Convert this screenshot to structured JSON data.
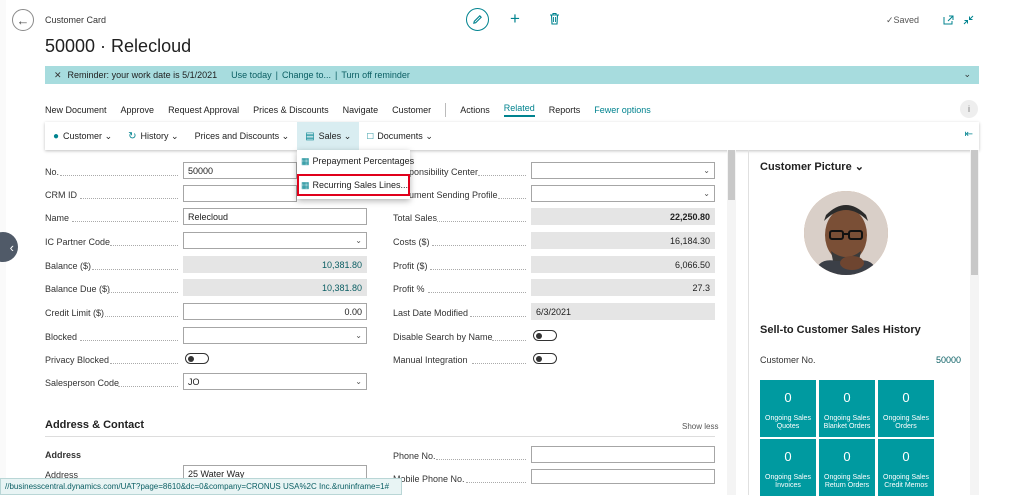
{
  "header": {
    "breadcrumb": "Customer Card",
    "title": "50000 · Relecloud",
    "saved_label": "Saved"
  },
  "reminder": {
    "text": "Reminder: your work date is 5/1/2021",
    "use_today": "Use today",
    "sep1": "|",
    "change_to": "Change to...",
    "sep2": "|",
    "turn_off": "Turn off reminder"
  },
  "action_tabs": [
    "New Document",
    "Approve",
    "Request Approval",
    "Prices & Discounts",
    "Navigate",
    "Customer",
    "Actions",
    "Related",
    "Reports",
    "Fewer options"
  ],
  "subbar": {
    "customer": "Customer",
    "history": "History",
    "prices": "Prices and Discounts",
    "sales": "Sales",
    "documents": "Documents"
  },
  "sales_menu": {
    "item1": "Prepayment Percentages",
    "item2": "Recurring Sales Lines..."
  },
  "general_left": {
    "no_label": "No.",
    "no_value": "50000",
    "crm_label": "CRM ID",
    "crm_value": "",
    "name_label": "Name",
    "name_value": "Relecloud",
    "ic_label": "IC Partner Code",
    "ic_value": "",
    "balance_label": "Balance ($)",
    "balance_value": "10,381.80",
    "baldue_label": "Balance Due ($)",
    "baldue_value": "10,381.80",
    "credit_label": "Credit Limit ($)",
    "credit_value": "0.00",
    "blocked_label": "Blocked",
    "blocked_value": "",
    "privacy_label": "Privacy Blocked",
    "sales_label": "Salesperson Code",
    "sales_value": "JO"
  },
  "general_right": {
    "resp_label": "Responsibility Center",
    "docsend_label": "Document Sending Profile",
    "total_label": "Total Sales",
    "total_value": "22,250.80",
    "costs_label": "Costs ($)",
    "costs_value": "16,184.30",
    "profit_label": "Profit ($)",
    "profit_value": "6,066.50",
    "profitpct_label": "Profit %",
    "profitpct_value": "27.3",
    "lastmod_label": "Last Date Modified",
    "lastmod_value": "6/3/2021",
    "disable_label": "Disable Search by Name",
    "manual_label": "Manual Integration"
  },
  "address": {
    "section_title": "Address & Contact",
    "show_less": "Show less",
    "sub_heading": "Address",
    "address_label": "Address",
    "address_value": "25 Water Way",
    "phone_label": "Phone No.",
    "mobile_label": "Mobile Phone No."
  },
  "factbox": {
    "picture_title": "Customer Picture",
    "history_title": "Sell-to Customer Sales History",
    "customer_no_label": "Customer No.",
    "customer_no_value": "50000",
    "tiles": [
      {
        "n": "0",
        "t": "Ongoing Sales Quotes"
      },
      {
        "n": "0",
        "t": "Ongoing Sales Blanket Orders"
      },
      {
        "n": "0",
        "t": "Ongoing Sales Orders"
      },
      {
        "n": "0",
        "t": "Ongoing Sales Invoices"
      },
      {
        "n": "0",
        "t": "Ongoing Sales Return Orders"
      },
      {
        "n": "0",
        "t": "Ongoing Sales Credit Memos"
      }
    ]
  },
  "status_url": "//businesscentral.dynamics.com/UAT?page=8610&dc=0&company=CRONUS USA%2C Inc.&runinframe=1#",
  "colors": {
    "accent": "#00838f",
    "reminder": "#a7dcde",
    "tile": "#009aa0",
    "highlight": "#e0001b"
  }
}
